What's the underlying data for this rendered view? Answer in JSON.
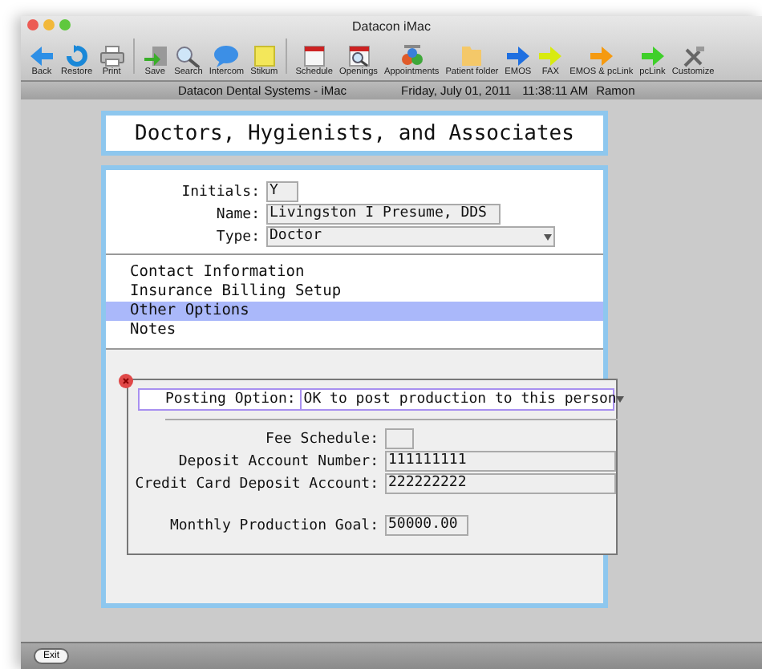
{
  "window": {
    "title": "Datacon iMac"
  },
  "toolbar": {
    "groups": [
      [
        {
          "label": "Back",
          "kind": "back"
        },
        {
          "label": "Restore",
          "kind": "restore"
        },
        {
          "label": "Print",
          "kind": "print"
        }
      ],
      [
        {
          "label": "Save",
          "kind": "save"
        },
        {
          "label": "Search",
          "kind": "search"
        },
        {
          "label": "Intercom",
          "kind": "bubble"
        },
        {
          "label": "Stikum",
          "kind": "note"
        }
      ],
      [
        {
          "label": "Schedule",
          "kind": "calendar"
        },
        {
          "label": "Openings",
          "kind": "openings"
        },
        {
          "label": "Appointments",
          "kind": "people"
        },
        {
          "label": "Patient folder",
          "kind": "folder"
        },
        {
          "label": "EMOS",
          "kind": "arrow",
          "color": "#1f6fe0"
        },
        {
          "label": "FAX",
          "kind": "arrow",
          "color": "#d8ea10"
        },
        {
          "label": "EMOS & pcLink",
          "kind": "arrow",
          "color": "#f59a10"
        },
        {
          "label": "pcLink",
          "kind": "arrow",
          "color": "#3fcf2a"
        },
        {
          "label": "Customize",
          "kind": "tools"
        }
      ]
    ]
  },
  "info_bar": {
    "practice": "Datacon Dental Systems - iMac",
    "date": "Friday, July 01, 2011",
    "time": "11:38:11 AM",
    "user": "Ramon"
  },
  "heading": "Doctors, Hygienists, and Associates",
  "fields": [
    {
      "label": "Initials:",
      "value": "Y",
      "kind": "short"
    },
    {
      "label": "Name:",
      "value": "Livingston I Presume, DDS",
      "kind": "text"
    },
    {
      "label": "Type:",
      "value": "Doctor",
      "kind": "select"
    }
  ],
  "sections": [
    {
      "label": "Contact Information",
      "selected": false
    },
    {
      "label": "Insurance Billing Setup",
      "selected": false
    },
    {
      "label": "Other Options",
      "selected": true
    },
    {
      "label": "Notes",
      "selected": false
    }
  ],
  "options": {
    "posting": {
      "label": "Posting Option:",
      "value": "OK to post production to this person"
    },
    "fields": [
      {
        "label": "Fee Schedule:",
        "kind": "short"
      },
      {
        "label": "Deposit Account Number:",
        "value": "111111111",
        "kind": "long"
      },
      {
        "label": "Credit Card Deposit Account:",
        "value": "222222222",
        "kind": "long"
      }
    ],
    "goal": {
      "label": "Monthly Production Goal:",
      "value": "50000.00"
    }
  },
  "footer": {
    "button": "Exit"
  }
}
